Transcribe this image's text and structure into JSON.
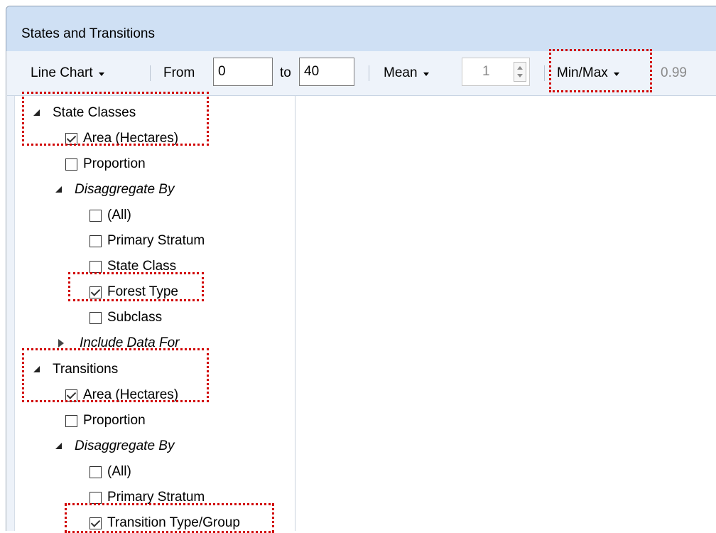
{
  "window": {
    "title": "States and Transitions"
  },
  "toolbar": {
    "chart_type": "Line Chart",
    "from_label": "From",
    "from_value": "0",
    "to_label": "to",
    "to_value": "40",
    "stat_label": "Mean",
    "stat_value": "1",
    "range_label": "Min/Max",
    "range_value": "0.99"
  },
  "tree": {
    "state_classes": {
      "label": "State Classes",
      "area": "Area (Hectares)",
      "proportion": "Proportion",
      "disaggregate": "Disaggregate By",
      "options": [
        "(All)",
        "Primary Stratum",
        "State Class",
        "Forest Type",
        "Subclass"
      ],
      "include": "Include Data For"
    },
    "transitions": {
      "label": "Transitions",
      "area": "Area (Hectares)",
      "proportion": "Proportion",
      "disaggregate": "Disaggregate By",
      "options": [
        "(All)",
        "Primary Stratum",
        "Transition Type/Group"
      ]
    }
  },
  "colors": {
    "highlight": "#d10000",
    "titlebar": "#cfe0f4",
    "toolbar": "#eef3fa"
  }
}
